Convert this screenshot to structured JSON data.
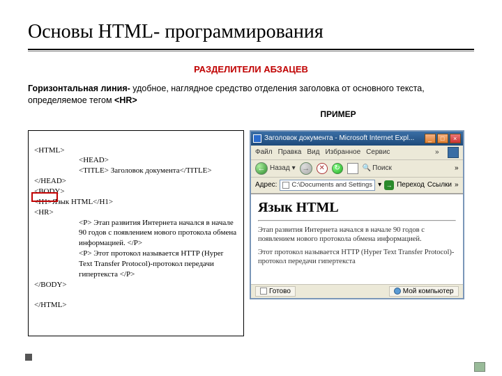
{
  "slide": {
    "title": "Основы HTML- программирования",
    "section_title": "РАЗДЕЛИТЕЛИ АБЗАЦЕВ",
    "body_bold": "Горизонтальная линия-",
    "body_rest": " удобное, наглядное средство отделения заголовка от основного текста, определяемое тегом ",
    "body_tag": "<HR>",
    "example_label": "ПРИМЕР"
  },
  "code": {
    "line1": "<HTML>",
    "line2": "<HEAD>",
    "line3": "<TITLE> Заголовок документа</TITLE>",
    "line4": "</HEAD>",
    "line5": "<BODY>",
    "line6": "<Н1>Язык HTML</Н1>",
    "line7": "<HR>",
    "line8": "<P> Этап развития Интернета начался в начале 90 годов с появлением нового протокола обмена информацией. </P>",
    "line9": "<P> Этот протокол называется HTTP (Hyper Text Transfer Protocol)-протокол передачи гипертекста </P>",
    "line10": "</BODY>",
    "line11": "</HTML>"
  },
  "ie": {
    "title": "Заголовок документа - Microsoft Internet Expl...",
    "menu": {
      "file": "Файл",
      "edit": "Правка",
      "view": "Вид",
      "favorites": "Избранное",
      "tools": "Сервис"
    },
    "toolbar": {
      "back": "Назад",
      "search": "Поиск"
    },
    "addressbar": {
      "label": "Адрес:",
      "value": "C:\\Documents and Settings",
      "go": "Переход",
      "links": "Ссылки"
    },
    "content": {
      "heading": "Язык HTML",
      "p1": "Этап развития Интернета начался в начале 90 годов с появлением нового протокола обмена информацией.",
      "p2": "Этот протокол называется HTTP (Hyper Text Transfer Protocol)-протокол передачи гипертекста"
    },
    "status": {
      "done": "Готово",
      "zone": "Мой компьютер"
    }
  }
}
